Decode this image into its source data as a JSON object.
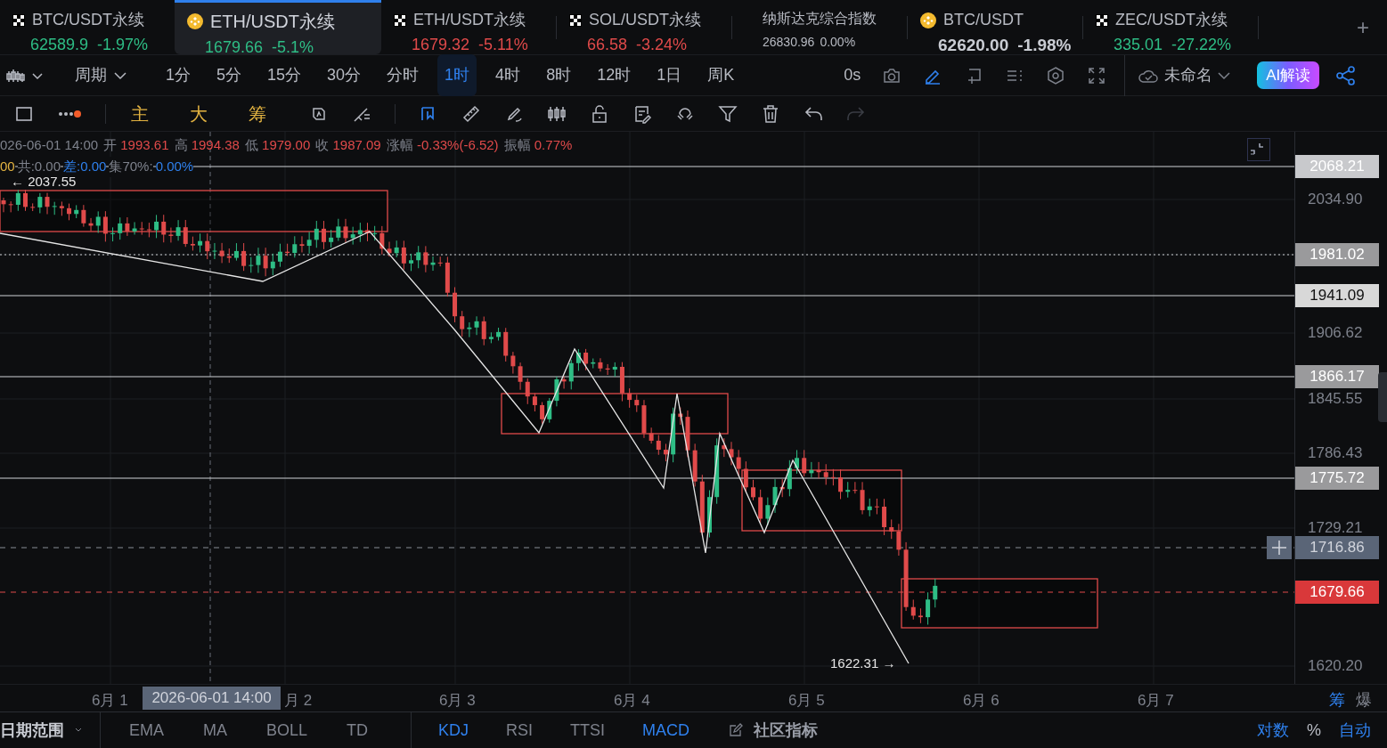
{
  "tickers": [
    {
      "kind": "checker",
      "symbol": "BTC/USDT永续",
      "price": "62589.9",
      "change": "-1.97%",
      "color": "#2ebd85",
      "selected": false
    },
    {
      "kind": "coin",
      "symbol": "ETH/USDT永续",
      "price": "1679.66",
      "change": "-5.1%",
      "color": "#2ebd85",
      "selected": true
    },
    {
      "kind": "checker",
      "symbol": "ETH/USDT永续",
      "price": "1679.32",
      "change": "-5.11%",
      "color": "#e04a4a",
      "selected": false
    },
    {
      "kind": "checker",
      "symbol": "SOL/USDT永续",
      "price": "66.58",
      "change": "-3.24%",
      "color": "#e04a4a",
      "selected": false
    },
    {
      "kind": "index",
      "symbol": "纳斯达克综合指数",
      "price": "26830.96",
      "change": "0.00%",
      "color": "#b7bac2",
      "selected": false
    },
    {
      "kind": "coin",
      "symbol": "BTC/USDT",
      "price": "62620.00",
      "change": "-1.98%",
      "color": "#c9ccd3",
      "selected": false
    },
    {
      "kind": "checker",
      "symbol": "ZEC/USDT永续",
      "price": "335.01",
      "change": "-27.22%",
      "color": "#2ebd85",
      "selected": false
    }
  ],
  "add_tab": "+",
  "toolbar": {
    "period_label": "周期",
    "intervals": [
      {
        "label": "1分",
        "selected": false
      },
      {
        "label": "5分",
        "selected": false
      },
      {
        "label": "15分",
        "selected": false
      },
      {
        "label": "30分",
        "selected": false
      },
      {
        "label": "分时",
        "selected": false
      },
      {
        "label": "1时",
        "selected": true
      },
      {
        "label": "4时",
        "selected": false
      },
      {
        "label": "8时",
        "selected": false
      },
      {
        "label": "12时",
        "selected": false
      },
      {
        "label": "1日",
        "selected": false
      },
      {
        "label": "周K",
        "selected": false
      }
    ],
    "countdown": "0s",
    "actions": [
      {
        "kind": "camera",
        "selected": false
      },
      {
        "kind": "pencil",
        "selected": true
      },
      {
        "kind": "add-window",
        "selected": false
      },
      {
        "kind": "list",
        "selected": false
      },
      {
        "kind": "hexagon",
        "selected": false
      },
      {
        "kind": "fullscreen",
        "selected": false
      }
    ],
    "layout_name": "未命名",
    "ai_button": "AI解读"
  },
  "drawing_bar": {
    "overlays": [
      "主",
      "大",
      "筹"
    ],
    "tools": [
      {
        "kind": "cursor",
        "selected": true
      },
      {
        "kind": "ruler",
        "selected": false
      },
      {
        "kind": "brush",
        "selected": false
      },
      {
        "kind": "candles",
        "selected": false
      },
      {
        "kind": "lock",
        "selected": false
      },
      {
        "kind": "note",
        "selected": false
      },
      {
        "kind": "magnet",
        "selected": false
      },
      {
        "kind": "filter",
        "selected": false
      },
      {
        "kind": "trash",
        "selected": false
      },
      {
        "kind": "undo",
        "selected": false
      },
      {
        "kind": "redo",
        "selected": false,
        "disabled": true
      }
    ]
  },
  "ohlc": {
    "datetime": "026-06-01 14:00",
    "fields": [
      {
        "label": "开",
        "value": "1993.61"
      },
      {
        "label": "高",
        "value": "1994.38"
      },
      {
        "label": "低",
        "value": "1979.00"
      },
      {
        "label": "收",
        "value": "1987.09"
      },
      {
        "label": "涨幅",
        "value": "-0.33%(-6.52)"
      },
      {
        "label": "振幅",
        "value": "0.77%"
      }
    ]
  },
  "chip_stats": [
    {
      "text": "00",
      "color": "#e3b341"
    },
    {
      "text": "共:0.00",
      "color": "#7e828c"
    },
    {
      "text": "差:0.00",
      "color": "#2f80ed"
    },
    {
      "text": "集70%:",
      "color": "#7e828c"
    },
    {
      "text": "0.00%",
      "color": "#2f80ed"
    }
  ],
  "chart_labels": [
    {
      "kind": "high",
      "text": "← 2037.55"
    },
    {
      "kind": "low",
      "text": "1622.31 →"
    }
  ],
  "price_axis": [
    {
      "kind": "light",
      "text": "2068.21"
    },
    {
      "kind": "tick",
      "text": "2034.90"
    },
    {
      "kind": "mid",
      "text": "1981.02"
    },
    {
      "kind": "pale",
      "text": "1941.09"
    },
    {
      "kind": "tick",
      "text": "1906.62"
    },
    {
      "kind": "mid",
      "text": "1866.17"
    },
    {
      "kind": "tick",
      "text": "1845.55"
    },
    {
      "kind": "tick",
      "text": "1786.43"
    },
    {
      "kind": "mid",
      "text": "1775.72"
    },
    {
      "kind": "tick",
      "text": "1729.21"
    },
    {
      "kind": "cross",
      "text": "1716.86"
    },
    {
      "kind": "last",
      "text": "1679.66"
    },
    {
      "kind": "tick",
      "text": "1620.20"
    }
  ],
  "time_axis": [
    "6月 1",
    "月 2",
    "6月 3",
    "6月 4",
    "6月 5",
    "6月 6",
    "6月 7"
  ],
  "crosshair_time": "2026-06-01 14:00",
  "axis_toggles": [
    {
      "label": "筹",
      "selected": true
    },
    {
      "label": "爆",
      "selected": false
    }
  ],
  "bottom_bar": {
    "range_label": "日期范围",
    "main_indicators": [
      {
        "label": "EMA",
        "selected": false
      },
      {
        "label": "MA",
        "selected": false
      },
      {
        "label": "BOLL",
        "selected": false
      },
      {
        "label": "TD",
        "selected": false
      }
    ],
    "sub_indicators": [
      {
        "label": "KDJ",
        "selected": true
      },
      {
        "label": "RSI",
        "selected": false
      },
      {
        "label": "TTSI",
        "selected": false
      },
      {
        "label": "MACD",
        "selected": true
      }
    ],
    "community": "社区指标",
    "scale_options": [
      {
        "label": "对数",
        "selected": true
      },
      {
        "label": "%",
        "selected": false
      },
      {
        "label": "自动",
        "selected": true
      }
    ]
  }
}
